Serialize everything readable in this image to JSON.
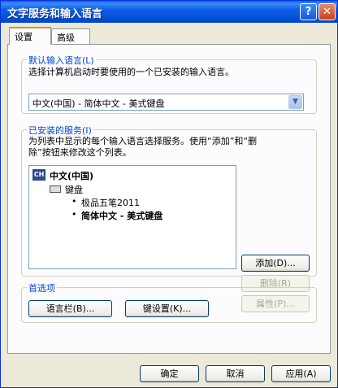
{
  "window": {
    "title": "文字服务和输入语言"
  },
  "titlebar": {
    "help_label": "?",
    "close_label": "✕"
  },
  "tabs": [
    {
      "label": "设置"
    },
    {
      "label": "高级"
    }
  ],
  "default_lang": {
    "group_label": "默认输入语言(L)",
    "description": "选择计算机启动时要使用的一个已安装的输入语言。",
    "selected": "中文(中国) - 简体中文 - 美式键盘"
  },
  "installed": {
    "group_label": "已安装的服务(I)",
    "description_line1": "为列表中显示的每个输入语言选择服务。使用“添加”和“删",
    "description_line2": "除”按钮来修改这个列表。",
    "tree": {
      "language_code": "CH",
      "language": "中文(中国)",
      "category": "键盘",
      "items": [
        "极品五笔2011",
        "简体中文 - 美式键盘"
      ]
    },
    "add_label": "添加(D)...",
    "remove_label": "删除(R)",
    "properties_label": "属性(P)..."
  },
  "preferences": {
    "group_label": "首选项",
    "language_bar_label": "语言栏(B)...",
    "key_settings_label": "键设置(K)..."
  },
  "footer": {
    "ok_label": "确定",
    "cancel_label": "取消",
    "apply_label": "应用(A)"
  }
}
